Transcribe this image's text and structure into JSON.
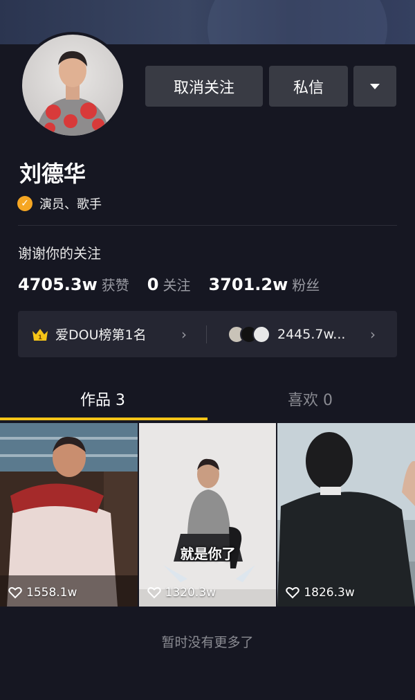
{
  "profile": {
    "name": "刘德华",
    "verify_text": "演员、歌手",
    "bio": "谢谢你的关注"
  },
  "actions": {
    "unfollow_label": "取消关注",
    "message_label": "私信",
    "more_icon": "caret-down-icon"
  },
  "stats": [
    {
      "value": "4705.3w",
      "label": "获赞"
    },
    {
      "value": "0",
      "label": "关注"
    },
    {
      "value": "3701.2w",
      "label": "粉丝"
    }
  ],
  "rank": {
    "crown_badge": "1",
    "left_label": "爱DOU榜第1名",
    "right_label": "2445.7w..."
  },
  "tabs": [
    {
      "label": "作品 3",
      "active": true
    },
    {
      "label": "喜欢 0",
      "active": false
    }
  ],
  "videos": [
    {
      "likes": "1558.1w"
    },
    {
      "likes": "1320.3w",
      "caption": "就是你了"
    },
    {
      "likes": "1826.3w"
    }
  ],
  "footer_text": "暂时没有更多了",
  "colors": {
    "background": "#161722",
    "button": "#393b44",
    "accent_tab": "#f5c518",
    "verify_badge": "#f5a623"
  }
}
